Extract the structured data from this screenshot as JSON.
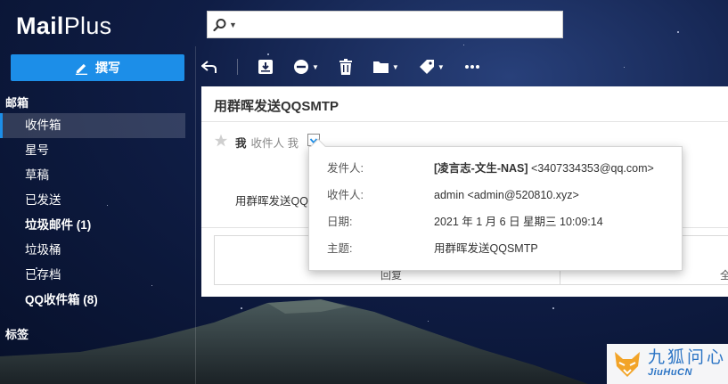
{
  "app": {
    "logo_bold": "Mail",
    "logo_rest": "Plus"
  },
  "search": {
    "value": "",
    "placeholder": ""
  },
  "sidebar": {
    "compose_label": "撰写",
    "mailbox_title": "邮箱",
    "items": [
      {
        "label": "收件箱",
        "active": true,
        "bold": false
      },
      {
        "label": "星号",
        "active": false,
        "bold": false
      },
      {
        "label": "草稿",
        "active": false,
        "bold": false
      },
      {
        "label": "已发送",
        "active": false,
        "bold": false
      },
      {
        "label": "垃圾邮件 (1)",
        "active": false,
        "bold": true
      },
      {
        "label": "垃圾桶",
        "active": false,
        "bold": false
      },
      {
        "label": "已存档",
        "active": false,
        "bold": false
      },
      {
        "label": "QQ收件箱 (8)",
        "active": false,
        "bold": true
      }
    ],
    "tags_title": "标签"
  },
  "toolbar": {
    "icons": [
      "back-arrow-icon",
      "archive-icon",
      "block-icon",
      "trash-icon",
      "folder-icon",
      "tag-icon",
      "more-icon"
    ]
  },
  "mail": {
    "subject": "用群晖发送QQSMTP",
    "sender_short": "我",
    "recipient_short": "收件人 我",
    "body_preview": "用群晖发送QQSMTP",
    "reply_label": "回复",
    "reply_all_label": "全"
  },
  "popover": {
    "from_label": "发件人:",
    "from_name": "[凌言志-文生-NAS]",
    "from_email": " <3407334353@qq.com>",
    "to_label": "收件人:",
    "to_value": "admin <admin@520810.xyz>",
    "date_label": "日期:",
    "date_value": "2021 年 1 月 6 日 星期三 10:09:14",
    "subject_label": "主题:",
    "subject_value": "用群晖发送QQSMTP"
  },
  "watermark": {
    "cn": "九狐问心",
    "en": "JiuHuCN"
  },
  "colors": {
    "accent": "#1c8ee8",
    "watermark": "#2b74c5"
  }
}
